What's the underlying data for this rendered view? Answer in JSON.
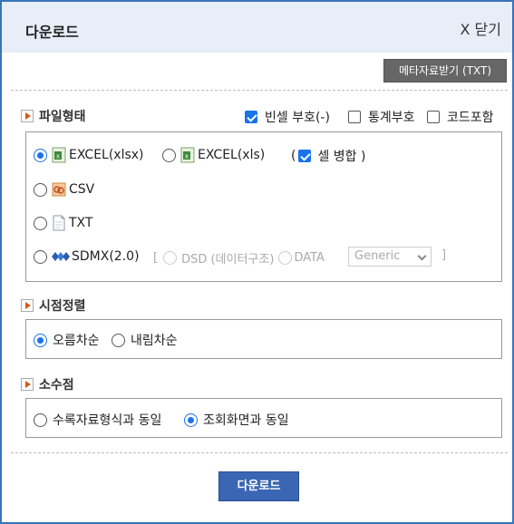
{
  "dialog": {
    "title": "다운로드",
    "close_label": "X 닫기",
    "meta_button": "메타자료받기 (TXT)",
    "download_button": "다운로드"
  },
  "file_format": {
    "heading": "파일형태",
    "header_options": [
      {
        "label": "빈셀 부호(-)",
        "checked": true
      },
      {
        "label": "통계부호",
        "checked": false
      },
      {
        "label": "코드포함",
        "checked": false
      }
    ],
    "options": [
      {
        "label": "EXCEL(xlsx)",
        "icon": "excel-icon",
        "selected": true
      },
      {
        "label": "EXCEL(xls)",
        "icon": "excel-icon",
        "selected": false
      },
      {
        "label": "CSV",
        "icon": "csv-icon",
        "selected": false
      },
      {
        "label": "TXT",
        "icon": "txt-icon",
        "selected": false
      },
      {
        "label": "SDMX(2.0)",
        "icon": "sdmx-icon",
        "selected": false
      }
    ],
    "merge_cells": {
      "open": "(",
      "label": "셀 병합 )",
      "checked": true
    },
    "sdmx_sub": {
      "bracket_open": "[",
      "dsd_label": "DSD (데이터구조)",
      "data_label": "DATA",
      "select_value": "Generic",
      "bracket_close": "]"
    }
  },
  "time_sort": {
    "heading": "시점정렬",
    "options": [
      {
        "label": "오름차순",
        "selected": true
      },
      {
        "label": "내림차순",
        "selected": false
      }
    ]
  },
  "decimal": {
    "heading": "소수점",
    "options": [
      {
        "label": "수록자료형식과 동일",
        "selected": false
      },
      {
        "label": "조회화면과 동일",
        "selected": true
      }
    ]
  },
  "colors": {
    "accent": "#3a66b3",
    "titlebar_bg": "#e8eef8",
    "border": "#3a73b8"
  }
}
